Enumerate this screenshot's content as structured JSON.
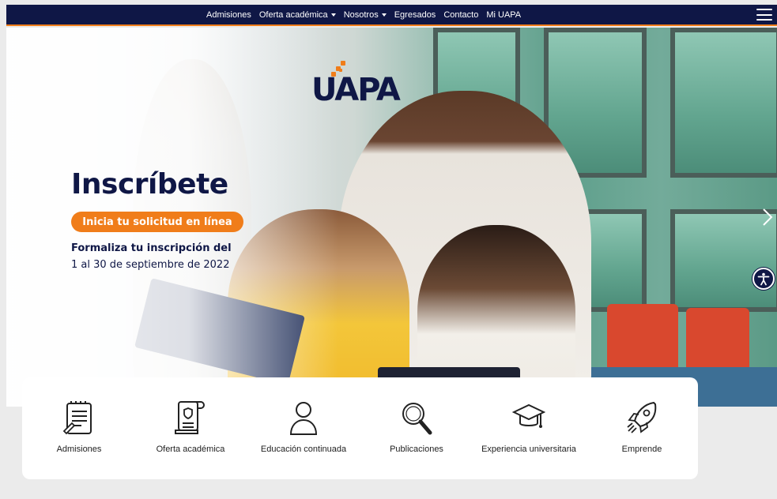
{
  "nav": {
    "items": [
      {
        "label": "Admisiones",
        "dropdown": false
      },
      {
        "label": "Oferta académica",
        "dropdown": true
      },
      {
        "label": "Nosotros",
        "dropdown": true
      },
      {
        "label": "Egresados",
        "dropdown": false
      },
      {
        "label": "Contacto",
        "dropdown": false
      },
      {
        "label": "Mi UAPA",
        "dropdown": false
      }
    ]
  },
  "hero": {
    "logo_text": "UAPA",
    "headline": "Inscríbete",
    "cta_label": "Inicia tu solicitud en línea",
    "subtitle_bold": "Formaliza tu inscripción del",
    "subtitle_dates": "1 al 30 de septiembre de 2022"
  },
  "quick_links": [
    {
      "label": "Admisiones",
      "icon": "clipboard-list-icon"
    },
    {
      "label": "Oferta académica",
      "icon": "certificate-scroll-icon"
    },
    {
      "label": "Educación continuada",
      "icon": "user-icon"
    },
    {
      "label": "Publicaciones",
      "icon": "magnifier-icon"
    },
    {
      "label": "Experiencia universitaria",
      "icon": "graduation-cap-icon"
    },
    {
      "label": "Emprende",
      "icon": "rocket-icon"
    }
  ],
  "colors": {
    "navy": "#0f1746",
    "orange": "#f07d1a",
    "page_bg": "#ebebeb"
  }
}
